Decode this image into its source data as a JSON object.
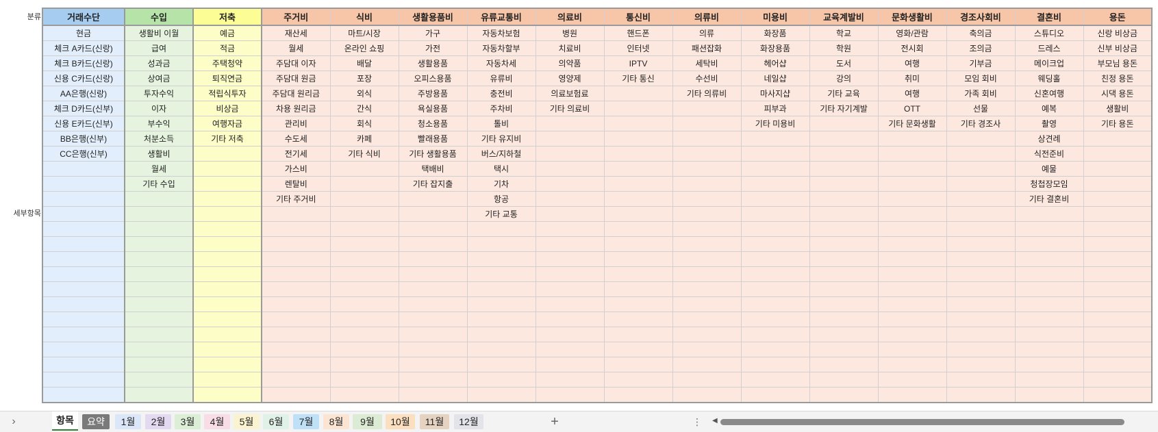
{
  "row_labels": {
    "category": "분류",
    "detail": "세부항목"
  },
  "columns": [
    {
      "header": "거래수단",
      "header_bg": "#a6cdf0",
      "cell_bg": "#e2eefb",
      "width": 120,
      "items": [
        "현금",
        "체크 A카드(신랑)",
        "체크 B카드(신랑)",
        "신용 C카드(신랑)",
        "AA은행(신랑)",
        "체크 D카드(신부)",
        "신용 E카드(신부)",
        "BB은행(신부)",
        "CC은행(신부)"
      ]
    },
    {
      "header": "수입",
      "header_bg": "#b6e3a8",
      "cell_bg": "#e6f4df",
      "width": 100,
      "items": [
        "생활비 이월",
        "급여",
        "성과금",
        "상여금",
        "투자수익",
        "이자",
        "부수익",
        "처분소득",
        "생활비",
        "월세",
        "기타 수입"
      ]
    },
    {
      "header": "저축",
      "header_bg": "#fdfd96",
      "cell_bg": "#fdfdc8",
      "width": 100,
      "items": [
        "예금",
        "적금",
        "주택청약",
        "퇴직연금",
        "적립식투자",
        "비상금",
        "여행자금",
        "기타 저축"
      ]
    },
    {
      "header": "주거비",
      "header_bg": "#f7c6a8",
      "cell_bg": "#fde8df",
      "width": 100,
      "items": [
        "재산세",
        "월세",
        "주담대 이자",
        "주담대 원금",
        "주담대 원리금",
        "차용 원리금",
        "관리비",
        "수도세",
        "전기세",
        "가스비",
        "렌탈비",
        "기타 주거비"
      ]
    },
    {
      "header": "식비",
      "header_bg": "#f7c6a8",
      "cell_bg": "#fde8df",
      "width": 100,
      "items": [
        "마트/시장",
        "온라인 쇼핑",
        "배달",
        "포장",
        "외식",
        "간식",
        "회식",
        "카페",
        "기타 식비"
      ]
    },
    {
      "header": "생활용품비",
      "header_bg": "#f7c6a8",
      "cell_bg": "#fde8df",
      "width": 100,
      "items": [
        "가구",
        "가전",
        "생활용품",
        "오피스용품",
        "주방용품",
        "욕실용품",
        "청소용품",
        "빨래용품",
        "기타 생활용품",
        "택배비",
        "기타 잡지출"
      ]
    },
    {
      "header": "유류교통비",
      "header_bg": "#f7c6a8",
      "cell_bg": "#fde8df",
      "width": 100,
      "items": [
        "자동차보험",
        "자동차할부",
        "자동차세",
        "유류비",
        "충전비",
        "주차비",
        "톨비",
        "기타 유지비",
        "버스/지하철",
        "택시",
        "기차",
        "항공",
        "기타 교통"
      ]
    },
    {
      "header": "의료비",
      "header_bg": "#f7c6a8",
      "cell_bg": "#fde8df",
      "width": 100,
      "items": [
        "병원",
        "치료비",
        "의약품",
        "영양제",
        "의료보험료",
        "기타 의료비"
      ]
    },
    {
      "header": "통신비",
      "header_bg": "#f7c6a8",
      "cell_bg": "#fde8df",
      "width": 100,
      "items": [
        "핸드폰",
        "인터넷",
        "IPTV",
        "기타 통신"
      ]
    },
    {
      "header": "의류비",
      "header_bg": "#f7c6a8",
      "cell_bg": "#fde8df",
      "width": 100,
      "items": [
        "의류",
        "패션잡화",
        "세탁비",
        "수선비",
        "기타 의류비"
      ]
    },
    {
      "header": "미용비",
      "header_bg": "#f7c6a8",
      "cell_bg": "#fde8df",
      "width": 100,
      "items": [
        "화장품",
        "화장용품",
        "헤어샵",
        "네일샵",
        "마사지샵",
        "피부과",
        "기타 미용비"
      ]
    },
    {
      "header": "교육계발비",
      "header_bg": "#f7c6a8",
      "cell_bg": "#fde8df",
      "width": 100,
      "items": [
        "학교",
        "학원",
        "도서",
        "강의",
        "기타 교육",
        "기타 자기계발"
      ]
    },
    {
      "header": "문화생활비",
      "header_bg": "#f7c6a8",
      "cell_bg": "#fde8df",
      "width": 100,
      "items": [
        "영화/관람",
        "전시회",
        "여행",
        "취미",
        "여행",
        "OTT",
        "기타 문화생활"
      ]
    },
    {
      "header": "경조사회비",
      "header_bg": "#f7c6a8",
      "cell_bg": "#fde8df",
      "width": 100,
      "items": [
        "축의금",
        "조의금",
        "기부금",
        "모임 회비",
        "가족 회비",
        "선물",
        "기타 경조사"
      ]
    },
    {
      "header": "결혼비",
      "header_bg": "#f7c6a8",
      "cell_bg": "#fde8df",
      "width": 100,
      "items": [
        "스튜디오",
        "드레스",
        "메이크업",
        "웨딩홀",
        "신혼여행",
        "예복",
        "촬영",
        "상견례",
        "식전준비",
        "예물",
        "청첩장모임",
        "기타 결혼비"
      ]
    },
    {
      "header": "용돈",
      "header_bg": "#f7c6a8",
      "cell_bg": "#fde8df",
      "width": 100,
      "items": [
        "신랑 비상금",
        "신부 비상금",
        "부모님 용돈",
        "친정 용돈",
        "시댁 용돈",
        "생활비",
        "기타 용돈"
      ]
    }
  ],
  "tabs": [
    {
      "label": "항목",
      "active": true,
      "bg": "#ffffff",
      "color": "#222222"
    },
    {
      "label": "요약",
      "bg": "#7a7a7a",
      "color": "#ffffff"
    },
    {
      "label": "1월",
      "bg": "#dbe7f8",
      "color": "#222222"
    },
    {
      "label": "2월",
      "bg": "#e3d9f0",
      "color": "#222222"
    },
    {
      "label": "3월",
      "bg": "#dcefd6",
      "color": "#222222"
    },
    {
      "label": "4월",
      "bg": "#f8dde6",
      "color": "#222222"
    },
    {
      "label": "5월",
      "bg": "#fbf3cf",
      "color": "#222222"
    },
    {
      "label": "6월",
      "bg": "#e0f1e8",
      "color": "#222222"
    },
    {
      "label": "7월",
      "bg": "#bfe1f7",
      "color": "#222222"
    },
    {
      "label": "8월",
      "bg": "#fbe5d2",
      "color": "#222222"
    },
    {
      "label": "9월",
      "bg": "#dcebd4",
      "color": "#222222"
    },
    {
      "label": "10월",
      "bg": "#fbdfbe",
      "color": "#222222"
    },
    {
      "label": "11월",
      "bg": "#e6d2c1",
      "color": "#222222"
    },
    {
      "label": "12월",
      "bg": "#e3e3ea",
      "color": "#222222"
    }
  ],
  "icons": {
    "scroll_left": "chevron-right-icon",
    "add_sheet": "plus-icon",
    "more": "vertical-dots-icon"
  },
  "grid_rows": 25
}
